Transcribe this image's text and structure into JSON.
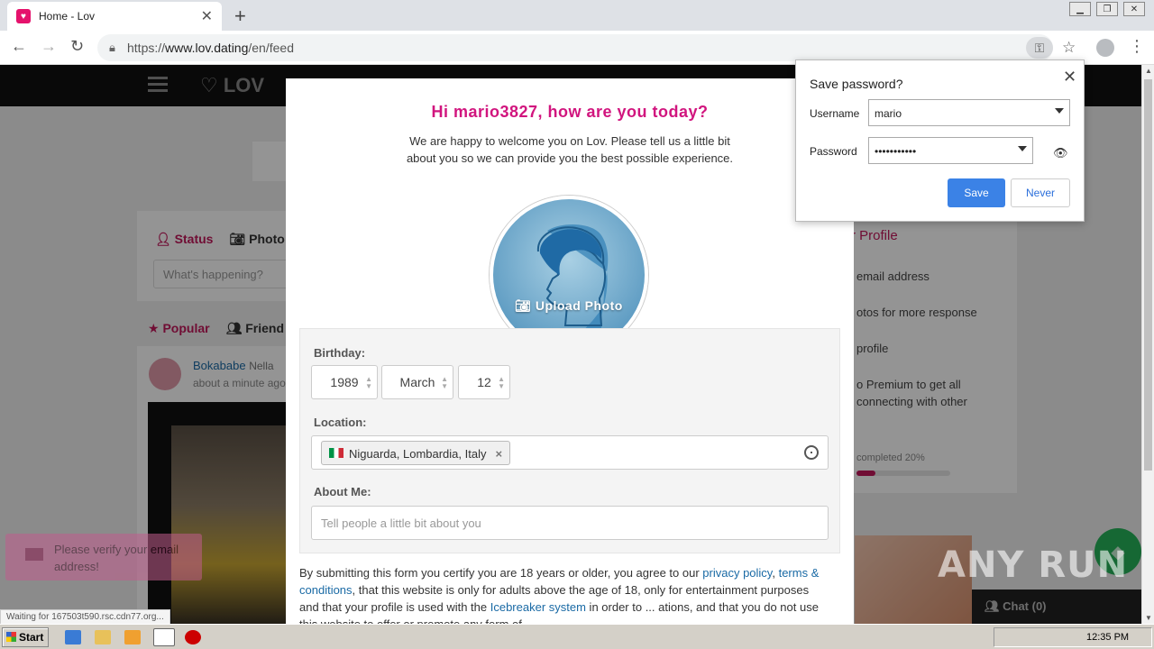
{
  "browser": {
    "tab_title": "Home - Lov",
    "url_scheme": "https://",
    "url_host": "www.lov.dating",
    "url_path": "/en/feed"
  },
  "site": {
    "logo": "LOV",
    "status_tabs": [
      "Status",
      "Photo"
    ],
    "status_placeholder": "What's happening?",
    "feed_tabs": [
      "Popular",
      "Friend"
    ],
    "post_author": "Bokababe",
    "post_author_sub": "Nella",
    "post_time": "about a minute ago",
    "profile_title": "r Profile",
    "profile_items": [
      "email address",
      "otos for more response",
      "profile",
      "o Premium to get all",
      "connecting with other"
    ],
    "profile_progress_label": "completed 20%",
    "profile_progress": 0.2,
    "chat_label": "Chat (0)",
    "verify_toast": "Please verify your email address!",
    "status_bubble": "Waiting for 167503t590.rsc.cdn77.org..."
  },
  "modal": {
    "title": "Hi mario3827, how are you today?",
    "intro": "We are happy to welcome you on Lov. Please tell us a little bit about you so we can provide you the best possible experience.",
    "upload_label": "Upload Photo",
    "birthday_label": "Birthday:",
    "birth_year": "1989",
    "birth_month": "March",
    "birth_day": "12",
    "location_label": "Location:",
    "location_value": "Niguarda, Lombardia, Italy",
    "about_label": "About Me:",
    "about_placeholder": "Tell people a little bit about you",
    "consent_1": "By submitting this form you certify you are 18 years or older, you agree to our ",
    "privacy_link": "privacy policy",
    "consent_2": ",",
    "terms_link": "terms & conditions",
    "consent_3": ", that this website is only for adults above the age of 18, only for entertainment purposes and that your profile is used with the ",
    "icebreaker_link": "Icebreaker system",
    "consent_4": " in order to ... ations, and that you do not use this website to offer or promote any form of"
  },
  "password_popup": {
    "title": "Save password?",
    "username_label": "Username",
    "username_value": "mario",
    "password_label": "Password",
    "password_value": "•••••••••••",
    "save_label": "Save",
    "never_label": "Never"
  },
  "taskbar": {
    "start_label": "Start",
    "clock": "12:35 PM"
  },
  "watermark": "ANY RUN",
  "colors": {
    "brand_pink": "#d1157e",
    "link_blue": "#1a6aa5",
    "save_blue": "#3b82e6"
  }
}
